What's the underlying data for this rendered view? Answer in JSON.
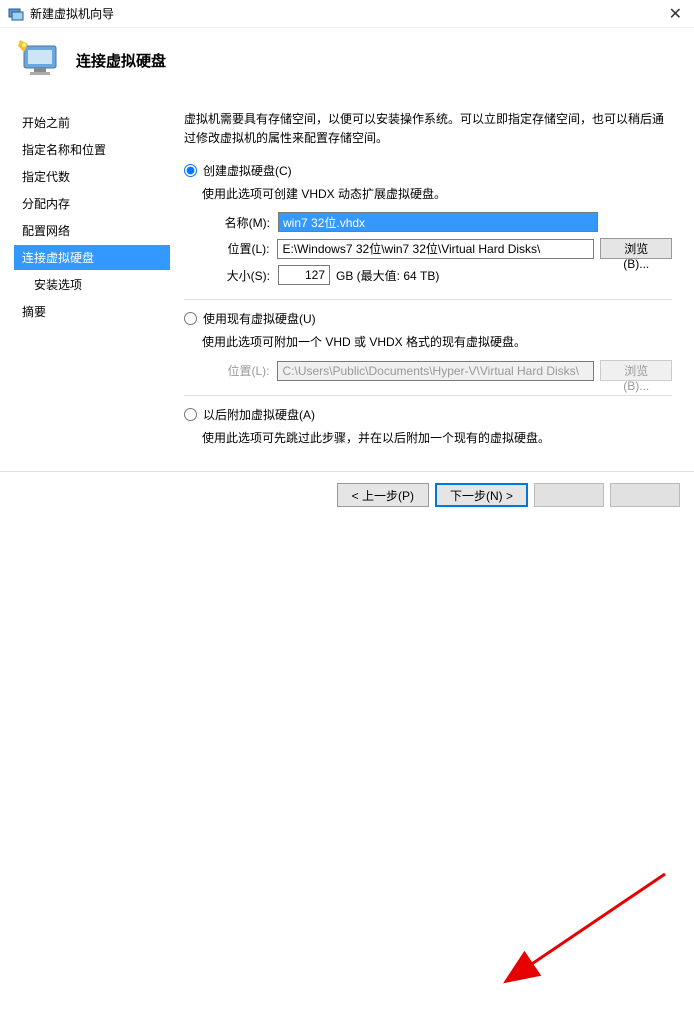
{
  "window": {
    "title": "新建虚拟机向导"
  },
  "header": {
    "title": "连接虚拟硬盘"
  },
  "sidebar": {
    "items": [
      {
        "label": "开始之前"
      },
      {
        "label": "指定名称和位置"
      },
      {
        "label": "指定代数"
      },
      {
        "label": "分配内存"
      },
      {
        "label": "配置网络"
      },
      {
        "label": "连接虚拟硬盘"
      },
      {
        "label": "安装选项"
      },
      {
        "label": "摘要"
      }
    ]
  },
  "content": {
    "intro": "虚拟机需要具有存储空间，以便可以安装操作系统。可以立即指定存储空间，也可以稍后通过修改虚拟机的属性来配置存储空间。",
    "opt1": {
      "label": "创建虚拟硬盘(C)",
      "desc": "使用此选项可创建 VHDX 动态扩展虚拟硬盘。",
      "name_lbl": "名称(M):",
      "name_val": "win7 32位.vhdx",
      "loc_lbl": "位置(L):",
      "loc_val": "E:\\Windows7 32位\\win7 32位\\Virtual Hard Disks\\",
      "browse": "浏览(B)...",
      "size_lbl": "大小(S):",
      "size_val": "127",
      "size_suffix": "GB (最大值: 64 TB)"
    },
    "opt2": {
      "label": "使用现有虚拟硬盘(U)",
      "desc": "使用此选项可附加一个 VHD 或 VHDX 格式的现有虚拟硬盘。",
      "loc_lbl": "位置(L):",
      "loc_val": "C:\\Users\\Public\\Documents\\Hyper-V\\Virtual Hard Disks\\",
      "browse": "浏览(B)..."
    },
    "opt3": {
      "label": "以后附加虚拟硬盘(A)",
      "desc": "使用此选项可先跳过此步骤，并在以后附加一个现有的虚拟硬盘。"
    }
  },
  "footer": {
    "prev": "< 上一步(P)",
    "next": "下一步(N) >"
  }
}
